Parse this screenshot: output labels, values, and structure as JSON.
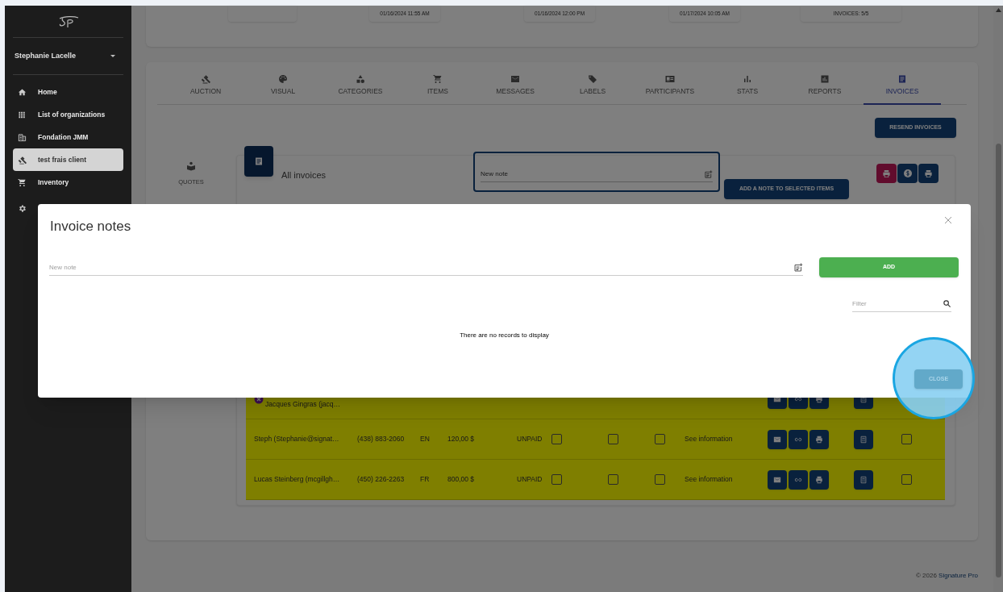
{
  "sidebar": {
    "user": "Stephanie Lacelle",
    "items": [
      {
        "label": "Home",
        "selected": false
      },
      {
        "label": "List of organizations",
        "selected": false
      },
      {
        "label": "Fondation JMM",
        "selected": false
      },
      {
        "label": "test frais client",
        "selected": true
      },
      {
        "label": "Inventory",
        "selected": false
      }
    ]
  },
  "summary_cards": [
    "01/16/2024 11:55 AM",
    "01/16/2024 12:00 PM",
    "01/17/2024 10:05 AM",
    "INVOICES: 5/5"
  ],
  "tabs": [
    {
      "label": "AUCTION",
      "selected": false
    },
    {
      "label": "VISUAL",
      "selected": false
    },
    {
      "label": "CATEGORIES",
      "selected": false
    },
    {
      "label": "ITEMS",
      "selected": false
    },
    {
      "label": "MESSAGES",
      "selected": false
    },
    {
      "label": "LABELS",
      "selected": false
    },
    {
      "label": "PARTICIPANTS",
      "selected": false
    },
    {
      "label": "STATS",
      "selected": false
    },
    {
      "label": "REPORTS",
      "selected": false
    },
    {
      "label": "INVOICES",
      "selected": true
    }
  ],
  "resend_button": "RESEND INVOICES",
  "side_tabs": [
    {
      "label": "QUOTES",
      "selected": false
    }
  ],
  "invoices_panel": {
    "title": "All invoices",
    "note_field": {
      "placeholder": "New note"
    },
    "add_note_button": "ADD A NOTE TO SELECTED ITEMS"
  },
  "rows": [
    {
      "flagged": true,
      "name": "Jacques Gingras (jacq…"
    },
    {
      "flagged": false,
      "name": "Steph (Stephanie@signat…",
      "phone": "(438) 883-2060",
      "language": "EN",
      "amount": "120,00 $",
      "status": "UNPAID",
      "checks": [
        false,
        false,
        false,
        false
      ],
      "info_link": "See information"
    },
    {
      "flagged": false,
      "name": "Lucas Steinberg (mcgillgh…",
      "phone": "(450) 226-2263",
      "language": "FR",
      "amount": "800,00 $",
      "status": "UNPAID",
      "checks": [
        false,
        false,
        false,
        false
      ],
      "info_link": "See information"
    }
  ],
  "modal": {
    "title": "Invoice notes",
    "note_field": {
      "placeholder": "New note"
    },
    "add_button": "ADD",
    "filter": {
      "placeholder": "Filter"
    },
    "empty_message": "There are no records to display",
    "close_button": "CLOSE"
  },
  "footer": {
    "copyright": "© 2026",
    "link": "Signature Pro"
  }
}
